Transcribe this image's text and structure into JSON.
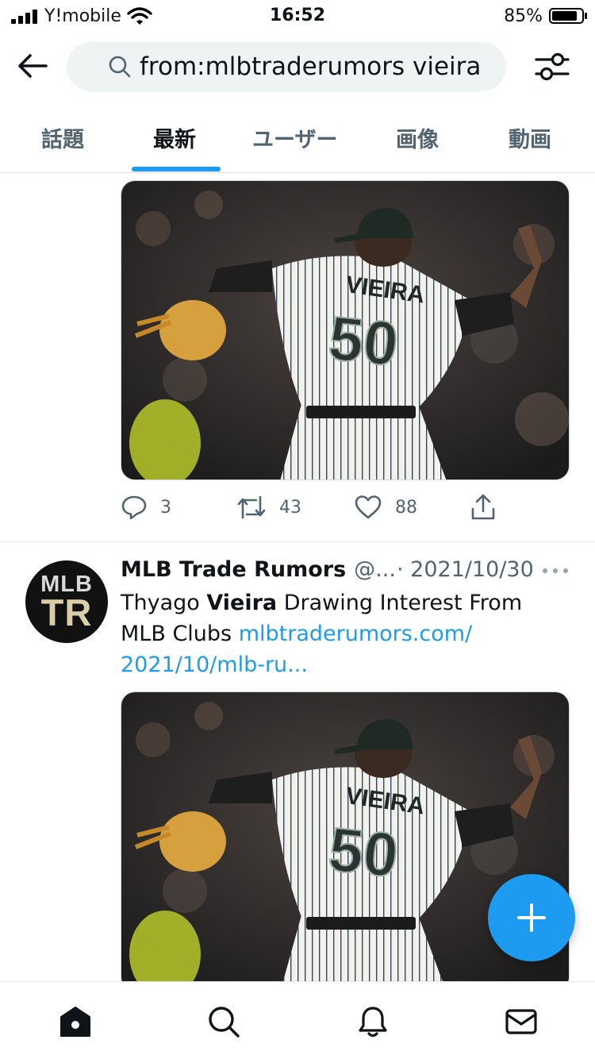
{
  "status_bar": {
    "carrier": "Y!mobile",
    "time": "16:52",
    "battery_percent": "85%",
    "battery_level": 0.85,
    "icons": [
      "signal-icon",
      "wifi-icon",
      "battery-icon"
    ]
  },
  "header": {
    "back_icon": "back-arrow-icon",
    "search_query": "from:mlbtraderumors vieira",
    "search_icon": "search-icon",
    "filter_icon": "filter-sliders-icon"
  },
  "tabs": [
    {
      "label": "話題",
      "active": false
    },
    {
      "label": "最新",
      "active": true
    },
    {
      "label": "ユーザー",
      "active": false
    },
    {
      "label": "画像",
      "active": false
    },
    {
      "label": "動画",
      "active": false
    }
  ],
  "first_tweet": {
    "media_alt": "photo",
    "jersey_name": "VIEIRA",
    "jersey_number": "50",
    "actions": {
      "replies": "3",
      "retweets": "43",
      "likes": "88"
    }
  },
  "second_tweet": {
    "avatar_text_top": "MLB",
    "avatar_text_bottom": "TR",
    "author_name": "MLB Trade Rumors",
    "author_handle": "@...",
    "date": "· 2021/10/30",
    "text_before": "Thyago ",
    "text_bold": "Vieira",
    "text_after": " Drawing Interest From MLB Clubs ",
    "link_line1": "mlbtraderumors.com/",
    "link_line2": "2021/10/mlb-ru...",
    "jersey_name": "VIEIRA",
    "jersey_number": "50"
  },
  "fab": {
    "icon": "plus-icon"
  },
  "bottom_nav": [
    {
      "icon": "home-icon",
      "active": true
    },
    {
      "icon": "search-icon",
      "active": false
    },
    {
      "icon": "notifications-bell-icon",
      "active": false
    },
    {
      "icon": "messages-envelope-icon",
      "active": false
    }
  ],
  "colors": {
    "accent": "#1d9bf0",
    "text_primary": "#0f1419",
    "text_secondary": "#536471"
  }
}
